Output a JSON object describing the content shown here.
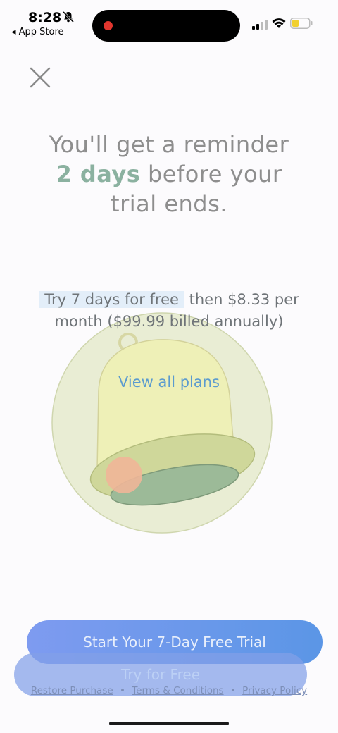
{
  "status_bar": {
    "time": "8:28",
    "back_app": "◂ App Store"
  },
  "headline": {
    "line1": "You'll get a reminder",
    "accent": "2 days",
    "line2_rest": "before your",
    "line3": "trial ends."
  },
  "offer": {
    "highlight": "Try 7 days for free",
    "rest": "then $8.33 per month ($99.99 billed annually)",
    "view_all_plans": "View all plans"
  },
  "buttons": {
    "primary": "Start Your 7-Day Free Trial",
    "secondary": "Try for Free"
  },
  "footer": {
    "restore": "Restore Purchase",
    "separator": "•",
    "terms": "Terms & Conditions",
    "privacy": "Privacy Policy"
  },
  "colors": {
    "accent_green": "#8bb1a0",
    "link_blue": "#5b9bcf",
    "button_blue": "#5b96e6"
  },
  "icons": [
    "bell-off-icon",
    "signal-icon",
    "wifi-icon",
    "battery-icon",
    "close-icon",
    "bell-illustration"
  ]
}
